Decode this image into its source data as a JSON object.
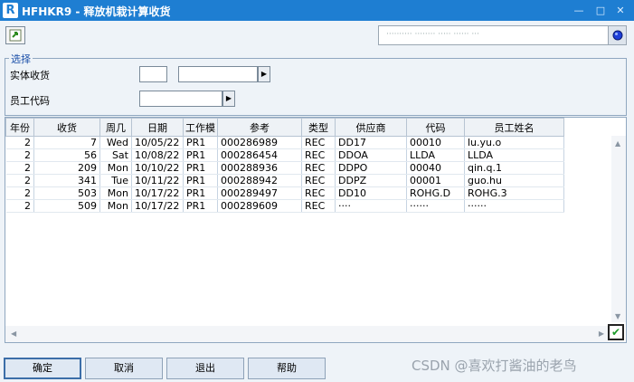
{
  "window": {
    "logo": "R",
    "title": "HFHKR9 - 释放机栽计算收货",
    "minimize": "—",
    "maximize": "□",
    "close": "✕"
  },
  "status": {
    "text": "·········· ········ ····· ······ ···"
  },
  "selection": {
    "legend": "选择",
    "physical_receipt_label": "实体收货",
    "employee_code_label": "员工代码",
    "physical_receipt_code": "",
    "physical_receipt_name": "",
    "employee_code": ""
  },
  "grid": {
    "columns": [
      "年份",
      "收货",
      "周几",
      "日期",
      "工作模",
      "参考",
      "类型",
      "供应商",
      "代码",
      "员工姓名"
    ],
    "rows": [
      [
        "2",
        "7",
        "Wed",
        "10/05/22",
        "PR1",
        "000286989",
        "REC",
        "DD17",
        "00010",
        "lu.yu.o"
      ],
      [
        "2",
        "56",
        "Sat",
        "10/08/22",
        "PR1",
        "000286454",
        "REC",
        "DDOA",
        "LLDA",
        "LLDA"
      ],
      [
        "2",
        "209",
        "Mon",
        "10/10/22",
        "PR1",
        "000288936",
        "REC",
        "DDPO",
        "00040",
        "qin.q.1"
      ],
      [
        "2",
        "341",
        "Tue",
        "10/11/22",
        "PR1",
        "000288942",
        "REC",
        "DDPZ",
        "00001",
        "guo.hu"
      ],
      [
        "2",
        "503",
        "Mon",
        "10/17/22",
        "PR1",
        "000289497",
        "REC",
        "DD10",
        "ROHG.D",
        "ROHG.3"
      ],
      [
        "2",
        "509",
        "Mon",
        "10/17/22",
        "PR1",
        "000289609",
        "REC",
        "····",
        "······",
        "······"
      ]
    ]
  },
  "buttons": {
    "ok": "确定",
    "cancel": "取消",
    "exit": "退出",
    "help": "帮助"
  },
  "watermark": "CSDN @喜欢打酱油的老鸟",
  "colors": {
    "titlebar": "#1e7ed2",
    "accent_check": "#1d9b2b"
  }
}
